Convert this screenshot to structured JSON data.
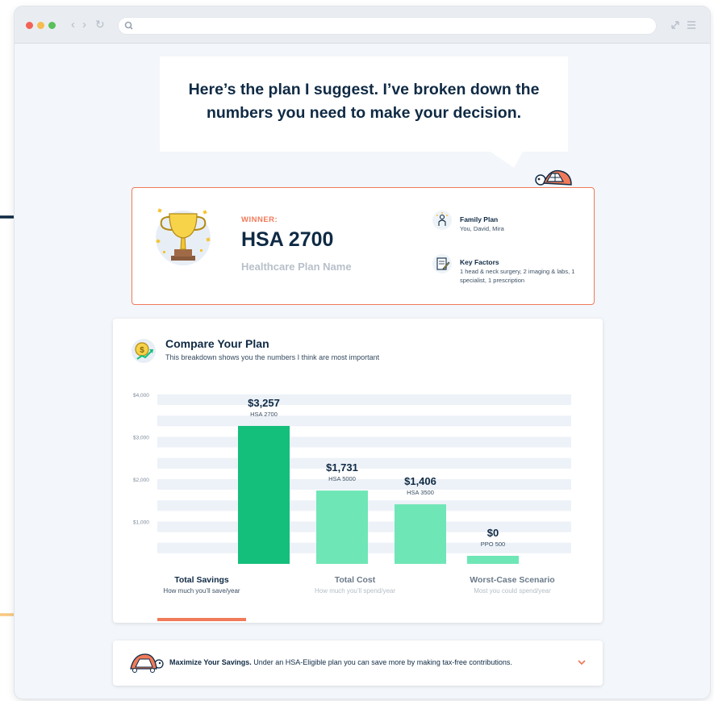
{
  "browser": {
    "nav_back": "‹",
    "nav_forward": "›",
    "nav_reload": "↻"
  },
  "bubble": {
    "line1": "Here’s the plan I suggest. I’ve broken down the",
    "line2": "numbers you need to make your decision."
  },
  "winner": {
    "label": "WINNER:",
    "plan": "HSA 2700",
    "subtitle": "Healthcare Plan Name",
    "family_title": "Family Plan",
    "family_desc": "You, David, Mira",
    "factors_title": "Key Factors",
    "factors_desc": "1 head & neck surgery, 2 imaging & labs, 1 specialist, 1 prescription"
  },
  "compare": {
    "title": "Compare Your Plan",
    "subtitle": "This breakdown shows you the numbers I think are most important"
  },
  "chart_data": {
    "type": "bar",
    "categories": [
      "HSA 2700",
      "HSA 5000",
      "HSA 3500",
      "PPO 500"
    ],
    "values": [
      3257,
      1731,
      1406,
      0
    ],
    "value_labels": [
      "$3,257",
      "$1,731",
      "$1,406",
      "$0"
    ],
    "ytick_labels": [
      "$4,000",
      "$3,000",
      "$2,000",
      "$1,000"
    ],
    "yticks": [
      4000,
      3000,
      2000,
      1000
    ],
    "ylim": [
      0,
      4000
    ],
    "colors": [
      "#14bf7c",
      "#6ee6b6",
      "#6ee6b6",
      "#6ee6b6"
    ],
    "stripe_color": "#edf2f8"
  },
  "tabs": [
    {
      "title": "Total Savings",
      "desc": "How much you’ll save/year",
      "active": true
    },
    {
      "title": "Total Cost",
      "desc": "How much you’ll spend/year",
      "active": false
    },
    {
      "title": "Worst-Case Scenario",
      "desc": "Most you could spend/year",
      "active": false
    }
  ],
  "savings": {
    "bold": "Maximize Your Savings.",
    "text": " Under an HSA-Eligible plan you can save more by making tax-free contributions."
  },
  "colors": {
    "accent": "#f07a5a",
    "navy": "#0f2a44",
    "arrow_dark": "#0f2a44",
    "arrow_light": "#f8c880",
    "bar_winner": "#14bf7c",
    "bar_other": "#6ee6b6"
  }
}
